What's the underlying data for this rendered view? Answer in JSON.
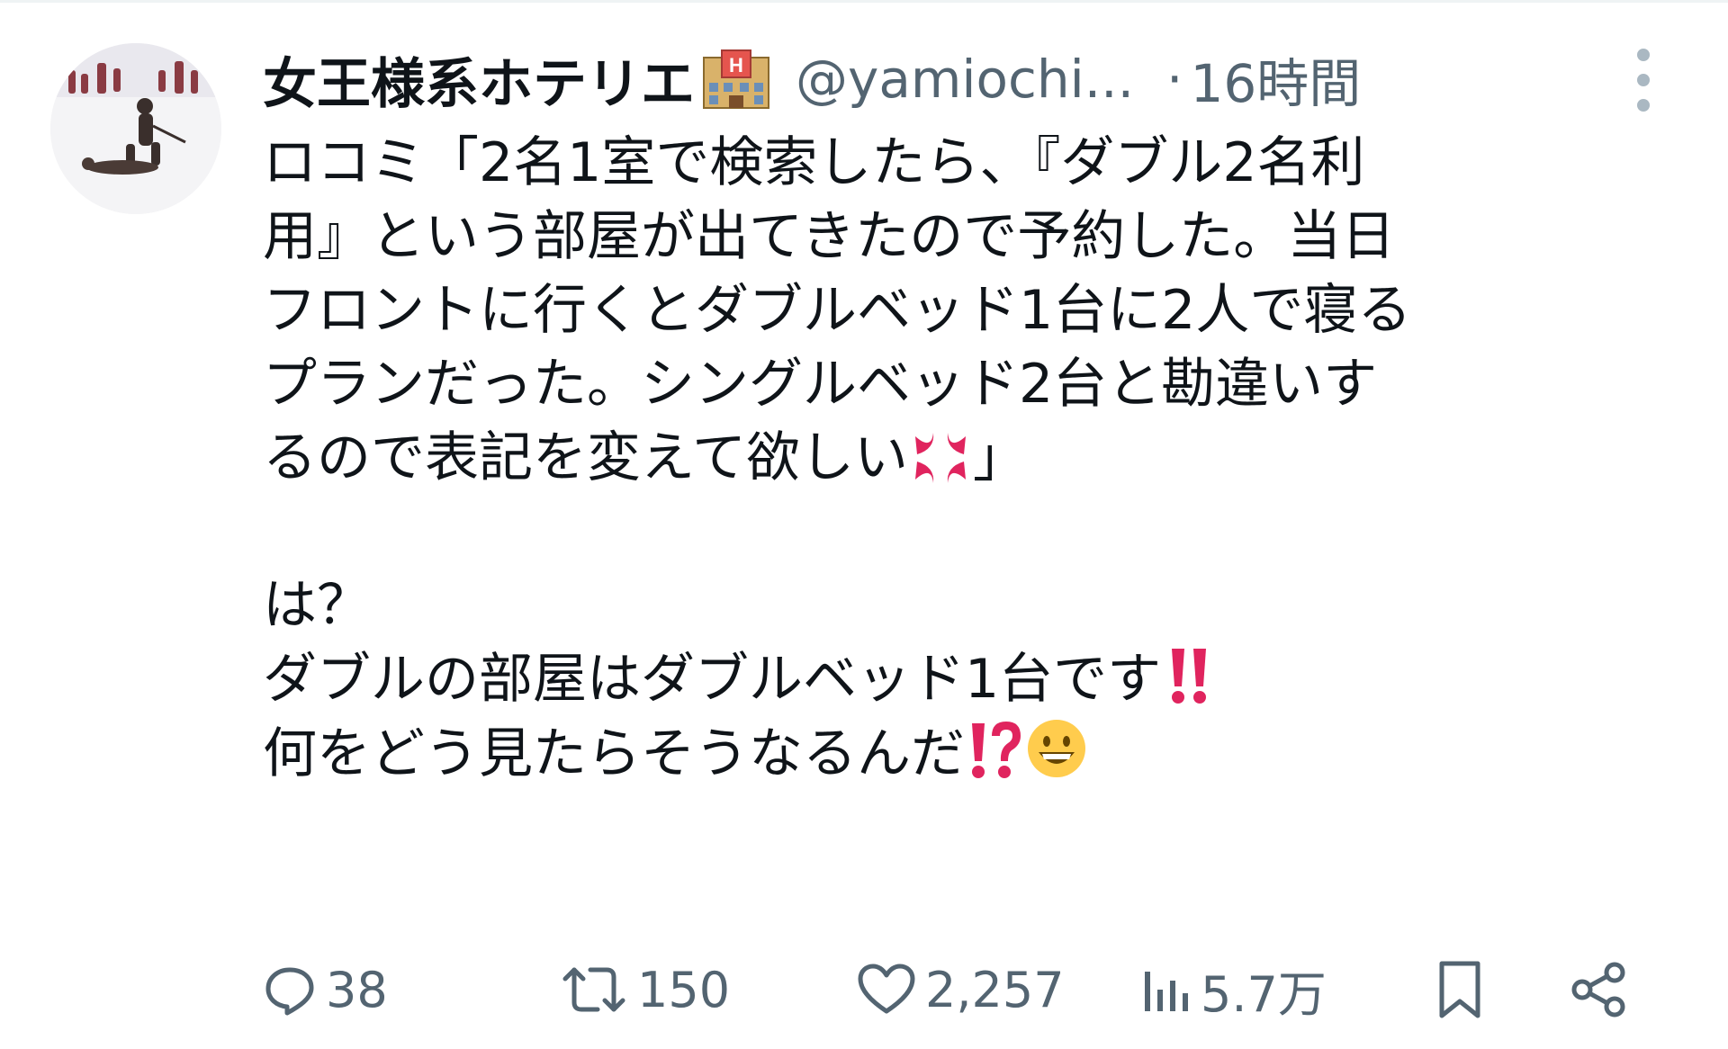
{
  "tweet": {
    "author": {
      "display_name": "女王様系ホテリエ",
      "handle": "@yamiochi...",
      "badge_emoji": "hotel-icon"
    },
    "separator": "·",
    "time": "16時間",
    "body": {
      "lines": [
        "ロコミ「2名1室で検索したら、『ダブル2名利",
        "用』という部屋が出てきたので予約した。当日",
        "フロントに行くとダブルベッド1台に2人で寝る",
        "プランだった。シングルベッド2台と勘違いす"
      ],
      "line5_text": "るので表記を変えて欲しい",
      "line5_emoji": "anger-icon",
      "line5_end": "」",
      "line6": "は？",
      "line7_text": "ダブルの部屋はダブルベッド1台です",
      "line7_emoji": "double-exclamation-icon",
      "line8_text": "何をどう見たらそうなるんだ",
      "line8_emoji1": "exclamation-question-icon",
      "line8_emoji2": "grinning-face-icon"
    },
    "actions": {
      "replies": "38",
      "retweets": "150",
      "likes": "2,257",
      "views": "5.7万"
    }
  },
  "colors": {
    "text": "#0f1419",
    "secondary": "#536471",
    "emoji_red": "#e0245e"
  }
}
